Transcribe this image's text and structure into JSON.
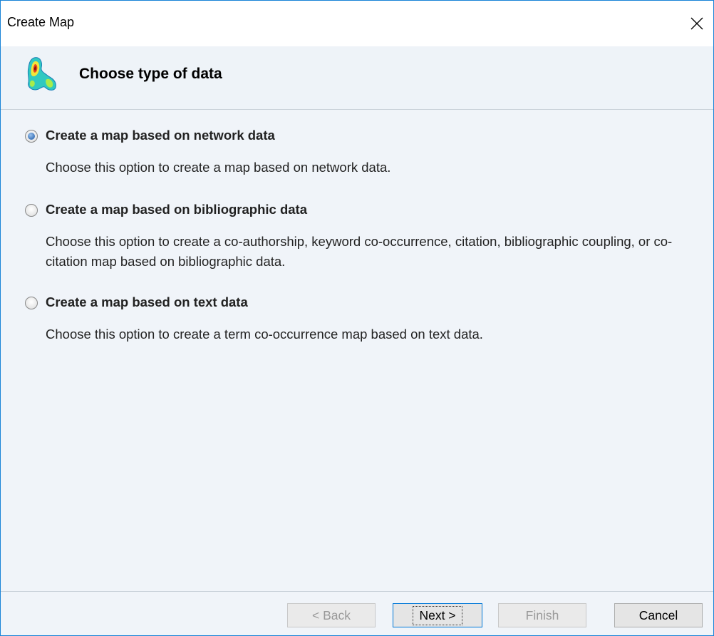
{
  "window": {
    "title": "Create Map"
  },
  "header": {
    "title": "Choose type of data"
  },
  "options": [
    {
      "label": "Create a map based on network data",
      "description": "Choose this option to create a map based on network data.",
      "selected": true
    },
    {
      "label": "Create a map based on bibliographic data",
      "description": "Choose this option to create a co-authorship, keyword co-occurrence, citation, bibliographic coupling, or co-citation map based on bibliographic data.",
      "selected": false
    },
    {
      "label": "Create a map based on text data",
      "description": "Choose this option to create a term co-occurrence map based on text data.",
      "selected": false
    }
  ],
  "buttons": {
    "back": "< Back",
    "next": "Next >",
    "finish": "Finish",
    "cancel": "Cancel"
  },
  "icons": {
    "header": "density-map-icon",
    "close": "close-icon"
  },
  "colors": {
    "window_border": "#1883d7",
    "content_bg": "#f0f4f9",
    "radio_selected": "#4a7fc0"
  }
}
